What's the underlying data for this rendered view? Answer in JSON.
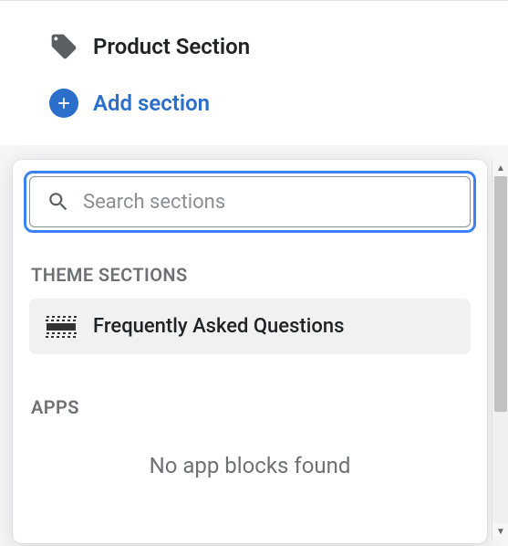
{
  "sections": {
    "items": [
      {
        "label": "Product Section"
      }
    ],
    "add_label": "Add section"
  },
  "picker": {
    "search_placeholder": "Search sections",
    "groups": {
      "theme": {
        "heading": "THEME SECTIONS",
        "items": [
          {
            "label": "Frequently Asked Questions"
          }
        ]
      },
      "apps": {
        "heading": "APPS",
        "empty": "No app blocks found"
      }
    }
  }
}
